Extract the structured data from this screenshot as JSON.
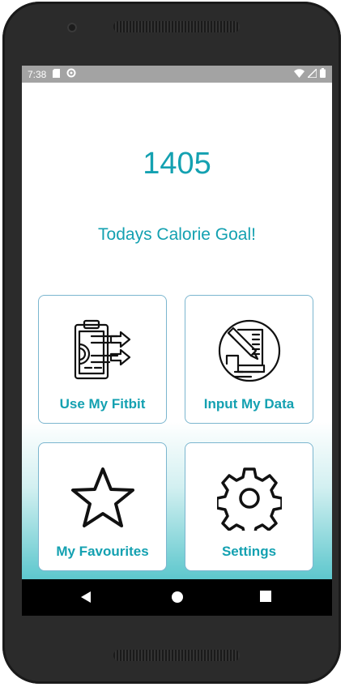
{
  "status_bar": {
    "time": "7:38",
    "icons_left": [
      "sd-card-icon",
      "sync-icon"
    ],
    "icons_right": [
      "wifi-icon",
      "signal-icon",
      "battery-icon"
    ]
  },
  "calorie": {
    "value": "1405",
    "label": "Todays Calorie Goal!"
  },
  "tiles": [
    {
      "label": "Use My Fitbit",
      "icon": "clipboard-gear-arrows-icon"
    },
    {
      "label": "Input My Data",
      "icon": "document-pencil-icon"
    },
    {
      "label": "My Favourites",
      "icon": "star-icon"
    },
    {
      "label": "Settings",
      "icon": "gear-icon"
    }
  ],
  "nav_bar": {
    "buttons": [
      "back",
      "home",
      "recents"
    ]
  },
  "colors": {
    "accent": "#14a1b1",
    "tile_border": "#7bb6cf",
    "status_bar": "#a3a3a3",
    "gradient_bottom": "#48c0c6",
    "nav_bar": "#000000"
  }
}
